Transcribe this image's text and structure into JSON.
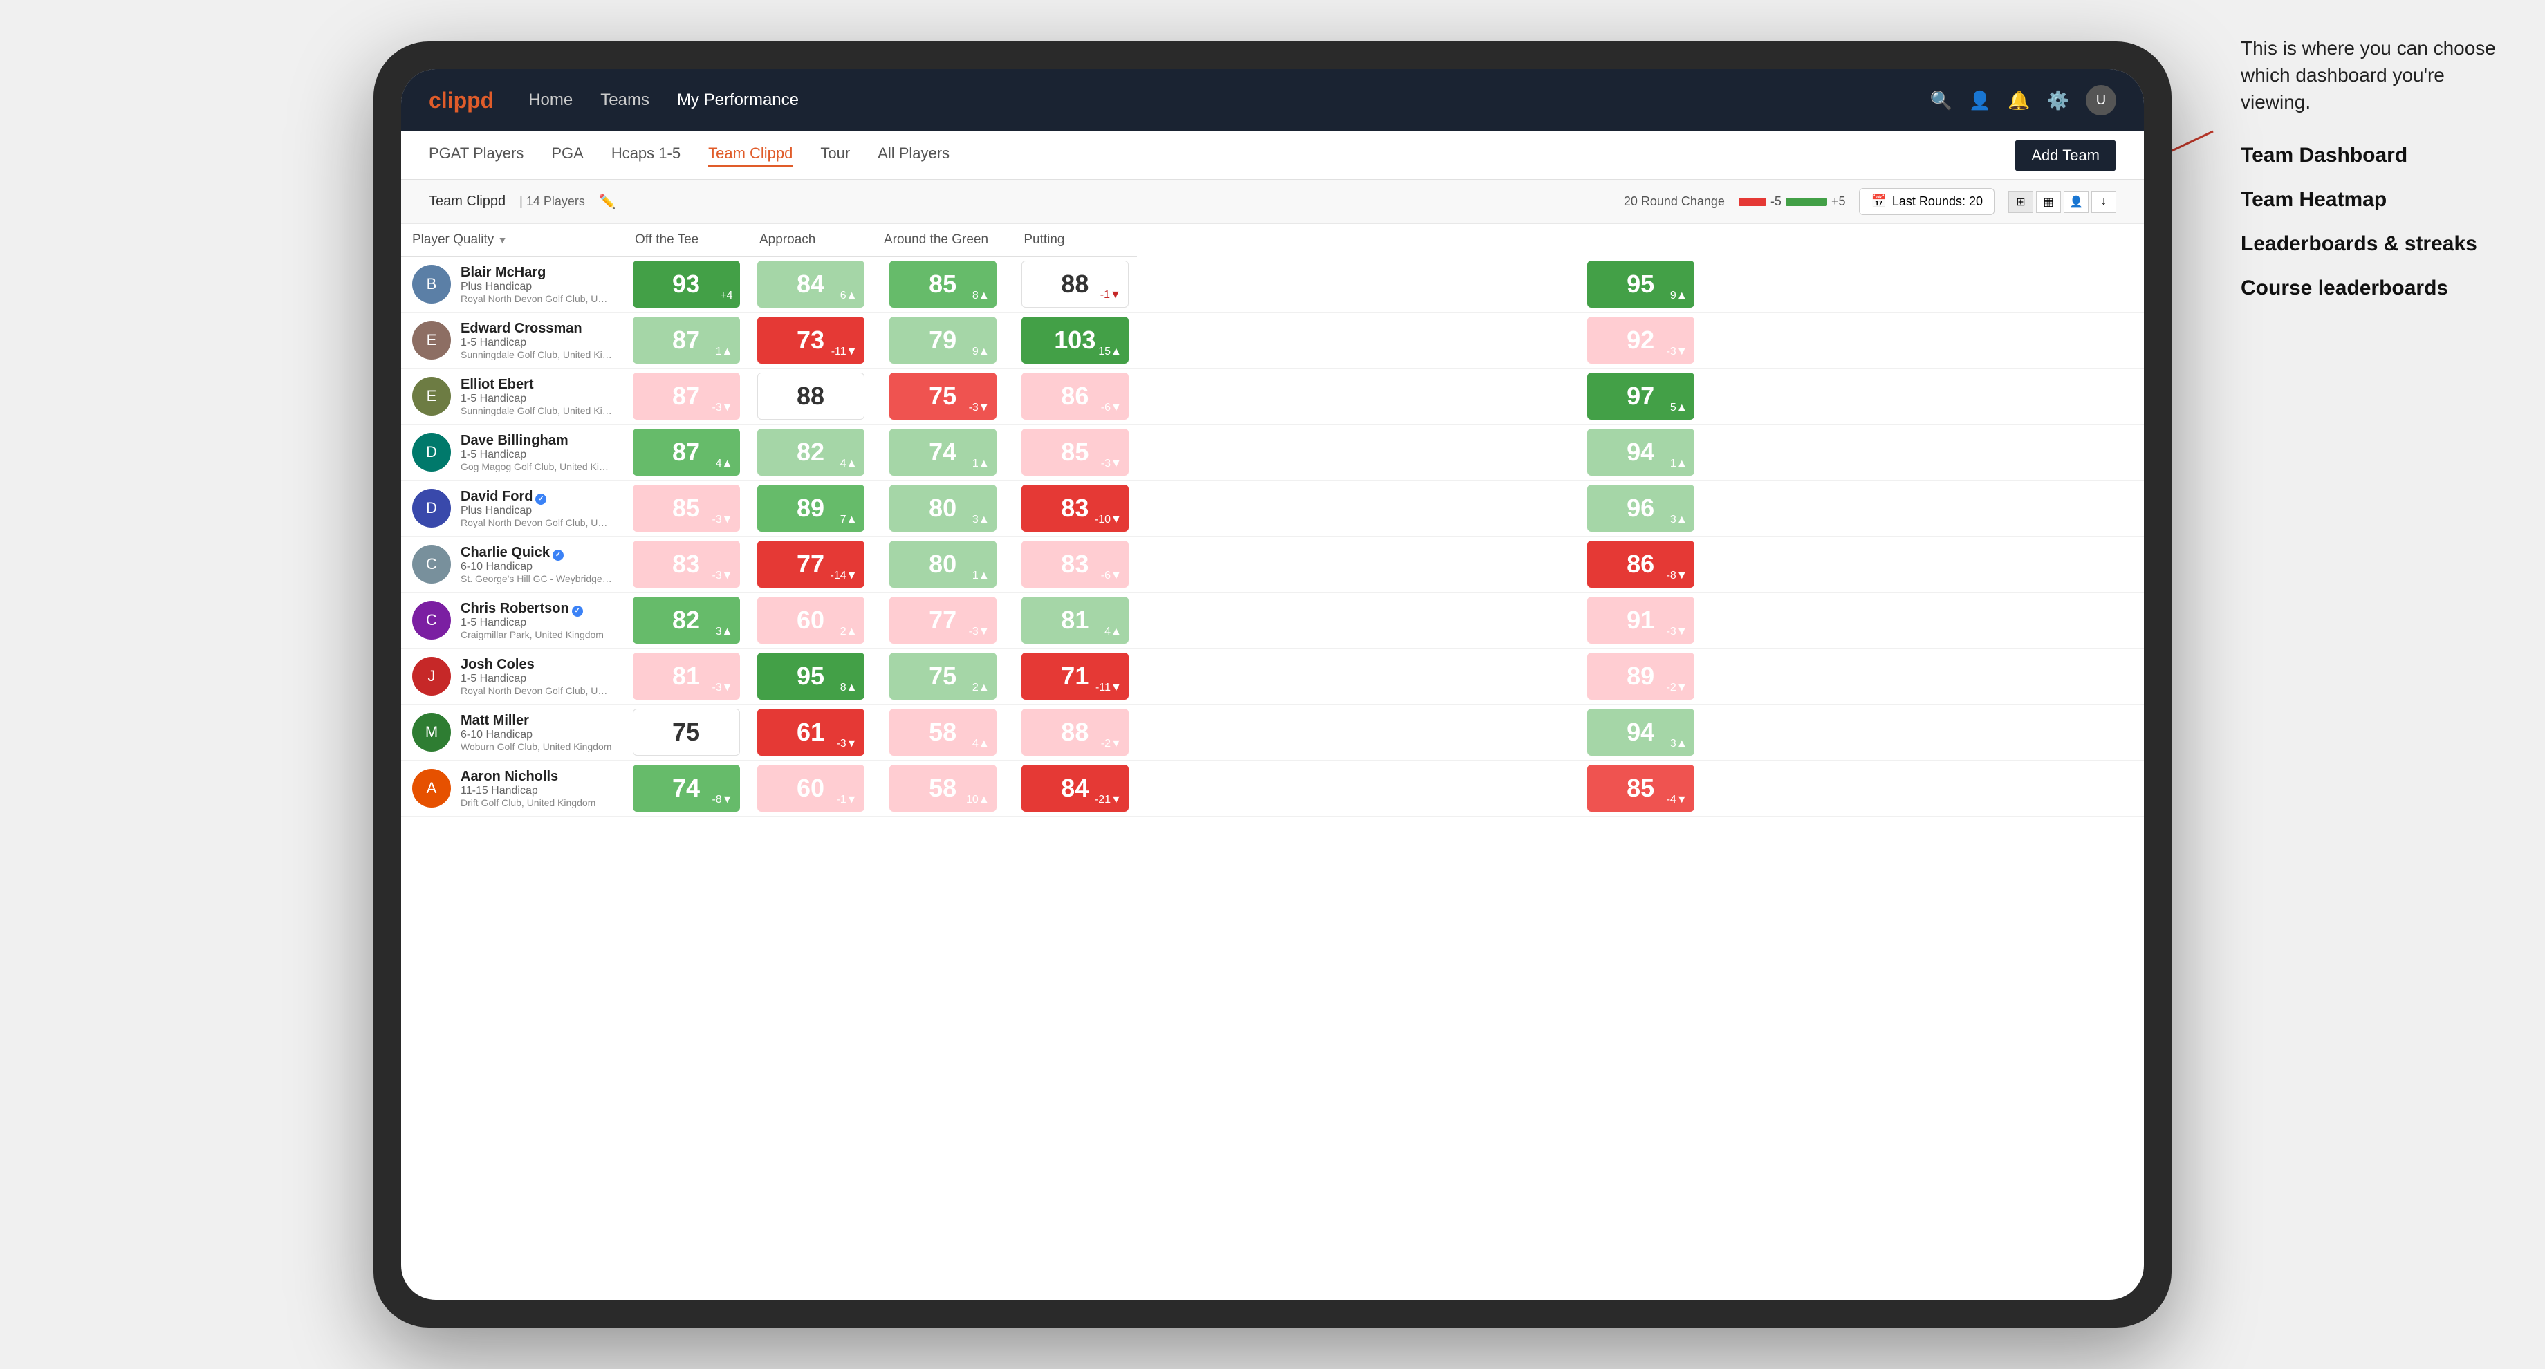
{
  "annotation": {
    "callout": "This is where you can choose which dashboard you're viewing.",
    "items": [
      "Team Dashboard",
      "Team Heatmap",
      "Leaderboards & streaks",
      "Course leaderboards"
    ]
  },
  "nav": {
    "logo": "clippd",
    "links": [
      "Home",
      "Teams",
      "My Performance"
    ],
    "active_link": "My Performance"
  },
  "sub_nav": {
    "links": [
      "PGAT Players",
      "PGA",
      "Hcaps 1-5",
      "Team Clippd",
      "Tour",
      "All Players"
    ],
    "active_link": "Team Clippd",
    "add_team_label": "Add Team"
  },
  "team_header": {
    "team_name": "Team Clippd",
    "separator": "|",
    "player_count": "14 Players",
    "round_change_label": "20 Round Change",
    "neg_label": "-5",
    "pos_label": "+5",
    "last_rounds_label": "Last Rounds: 20"
  },
  "columns": {
    "player_quality": "Player Quality",
    "off_tee": "Off the Tee",
    "approach": "Approach",
    "around_green": "Around the Green",
    "putting": "Putting"
  },
  "players": [
    {
      "name": "Blair McHarg",
      "handicap": "Plus Handicap",
      "club": "Royal North Devon Golf Club, United Kingdom",
      "avatar_color": "av-blue",
      "avatar_letter": "B",
      "scores": {
        "player_quality": {
          "value": 93,
          "change": "+4",
          "direction": "up",
          "bg": "bg-green-dark"
        },
        "off_tee": {
          "value": 84,
          "change": "6▲",
          "direction": "up",
          "bg": "bg-green-light"
        },
        "approach": {
          "value": 85,
          "change": "8▲",
          "direction": "up",
          "bg": "bg-green-med"
        },
        "around_green": {
          "value": 88,
          "change": "-1▼",
          "direction": "down",
          "bg": "bg-white"
        },
        "putting": {
          "value": 95,
          "change": "9▲",
          "direction": "up",
          "bg": "bg-green-dark"
        }
      }
    },
    {
      "name": "Edward Crossman",
      "handicap": "1-5 Handicap",
      "club": "Sunningdale Golf Club, United Kingdom",
      "avatar_color": "av-brown",
      "avatar_letter": "E",
      "scores": {
        "player_quality": {
          "value": 87,
          "change": "1▲",
          "direction": "up",
          "bg": "bg-green-light"
        },
        "off_tee": {
          "value": 73,
          "change": "-11▼",
          "direction": "down",
          "bg": "bg-red-dark"
        },
        "approach": {
          "value": 79,
          "change": "9▲",
          "direction": "up",
          "bg": "bg-green-light"
        },
        "around_green": {
          "value": 103,
          "change": "15▲",
          "direction": "up",
          "bg": "bg-green-dark"
        },
        "putting": {
          "value": 92,
          "change": "-3▼",
          "direction": "down",
          "bg": "bg-red-light"
        }
      }
    },
    {
      "name": "Elliot Ebert",
      "handicap": "1-5 Handicap",
      "club": "Sunningdale Golf Club, United Kingdom",
      "avatar_color": "av-olive",
      "avatar_letter": "E",
      "scores": {
        "player_quality": {
          "value": 87,
          "change": "-3▼",
          "direction": "down",
          "bg": "bg-red-light"
        },
        "off_tee": {
          "value": 88,
          "change": "",
          "direction": "",
          "bg": "bg-white"
        },
        "approach": {
          "value": 75,
          "change": "-3▼",
          "direction": "down",
          "bg": "bg-red-med"
        },
        "around_green": {
          "value": 86,
          "change": "-6▼",
          "direction": "down",
          "bg": "bg-red-light"
        },
        "putting": {
          "value": 97,
          "change": "5▲",
          "direction": "up",
          "bg": "bg-green-dark"
        }
      }
    },
    {
      "name": "Dave Billingham",
      "handicap": "1-5 Handicap",
      "club": "Gog Magog Golf Club, United Kingdom",
      "avatar_color": "av-teal",
      "avatar_letter": "D",
      "scores": {
        "player_quality": {
          "value": 87,
          "change": "4▲",
          "direction": "up",
          "bg": "bg-green-med"
        },
        "off_tee": {
          "value": 82,
          "change": "4▲",
          "direction": "up",
          "bg": "bg-green-light"
        },
        "approach": {
          "value": 74,
          "change": "1▲",
          "direction": "up",
          "bg": "bg-green-light"
        },
        "around_green": {
          "value": 85,
          "change": "-3▼",
          "direction": "down",
          "bg": "bg-red-light"
        },
        "putting": {
          "value": 94,
          "change": "1▲",
          "direction": "up",
          "bg": "bg-green-light"
        }
      }
    },
    {
      "name": "David Ford",
      "handicap": "Plus Handicap",
      "club": "Royal North Devon Golf Club, United Kingdom",
      "avatar_color": "av-navy",
      "avatar_letter": "D",
      "verified": true,
      "scores": {
        "player_quality": {
          "value": 85,
          "change": "-3▼",
          "direction": "down",
          "bg": "bg-red-light"
        },
        "off_tee": {
          "value": 89,
          "change": "7▲",
          "direction": "up",
          "bg": "bg-green-med"
        },
        "approach": {
          "value": 80,
          "change": "3▲",
          "direction": "up",
          "bg": "bg-green-light"
        },
        "around_green": {
          "value": 83,
          "change": "-10▼",
          "direction": "down",
          "bg": "bg-red-dark"
        },
        "putting": {
          "value": 96,
          "change": "3▲",
          "direction": "up",
          "bg": "bg-green-light"
        }
      }
    },
    {
      "name": "Charlie Quick",
      "handicap": "6-10 Handicap",
      "club": "St. George's Hill GC - Weybridge - Surrey, Uni...",
      "avatar_color": "av-gray",
      "avatar_letter": "C",
      "verified": true,
      "scores": {
        "player_quality": {
          "value": 83,
          "change": "-3▼",
          "direction": "down",
          "bg": "bg-red-light"
        },
        "off_tee": {
          "value": 77,
          "change": "-14▼",
          "direction": "down",
          "bg": "bg-red-dark"
        },
        "approach": {
          "value": 80,
          "change": "1▲",
          "direction": "up",
          "bg": "bg-green-light"
        },
        "around_green": {
          "value": 83,
          "change": "-6▼",
          "direction": "down",
          "bg": "bg-red-light"
        },
        "putting": {
          "value": 86,
          "change": "-8▼",
          "direction": "down",
          "bg": "bg-red-dark"
        }
      }
    },
    {
      "name": "Chris Robertson",
      "handicap": "1-5 Handicap",
      "club": "Craigmillar Park, United Kingdom",
      "avatar_color": "av-purple",
      "avatar_letter": "C",
      "verified": true,
      "scores": {
        "player_quality": {
          "value": 82,
          "change": "3▲",
          "direction": "up",
          "bg": "bg-green-med"
        },
        "off_tee": {
          "value": 60,
          "change": "2▲",
          "direction": "up",
          "bg": "bg-red-light"
        },
        "approach": {
          "value": 77,
          "change": "-3▼",
          "direction": "down",
          "bg": "bg-red-light"
        },
        "around_green": {
          "value": 81,
          "change": "4▲",
          "direction": "up",
          "bg": "bg-green-light"
        },
        "putting": {
          "value": 91,
          "change": "-3▼",
          "direction": "down",
          "bg": "bg-red-light"
        }
      }
    },
    {
      "name": "Josh Coles",
      "handicap": "1-5 Handicap",
      "club": "Royal North Devon Golf Club, United Kingdom",
      "avatar_color": "av-red",
      "avatar_letter": "J",
      "scores": {
        "player_quality": {
          "value": 81,
          "change": "-3▼",
          "direction": "down",
          "bg": "bg-red-light"
        },
        "off_tee": {
          "value": 95,
          "change": "8▲",
          "direction": "up",
          "bg": "bg-green-dark"
        },
        "approach": {
          "value": 75,
          "change": "2▲",
          "direction": "up",
          "bg": "bg-green-light"
        },
        "around_green": {
          "value": 71,
          "change": "-11▼",
          "direction": "down",
          "bg": "bg-red-dark"
        },
        "putting": {
          "value": 89,
          "change": "-2▼",
          "direction": "down",
          "bg": "bg-red-light"
        }
      }
    },
    {
      "name": "Matt Miller",
      "handicap": "6-10 Handicap",
      "club": "Woburn Golf Club, United Kingdom",
      "avatar_color": "av-green",
      "avatar_letter": "M",
      "scores": {
        "player_quality": {
          "value": 75,
          "change": "",
          "direction": "",
          "bg": "bg-white"
        },
        "off_tee": {
          "value": 61,
          "change": "-3▼",
          "direction": "down",
          "bg": "bg-red-dark"
        },
        "approach": {
          "value": 58,
          "change": "4▲",
          "direction": "up",
          "bg": "bg-red-light"
        },
        "around_green": {
          "value": 88,
          "change": "-2▼",
          "direction": "down",
          "bg": "bg-red-light"
        },
        "putting": {
          "value": 94,
          "change": "3▲",
          "direction": "up",
          "bg": "bg-green-light"
        }
      }
    },
    {
      "name": "Aaron Nicholls",
      "handicap": "11-15 Handicap",
      "club": "Drift Golf Club, United Kingdom",
      "avatar_color": "av-orange",
      "avatar_letter": "A",
      "scores": {
        "player_quality": {
          "value": 74,
          "change": "-8▼",
          "direction": "down",
          "bg": "bg-green-med"
        },
        "off_tee": {
          "value": 60,
          "change": "-1▼",
          "direction": "down",
          "bg": "bg-red-light"
        },
        "approach": {
          "value": 58,
          "change": "10▲",
          "direction": "up",
          "bg": "bg-red-light"
        },
        "around_green": {
          "value": 84,
          "change": "-21▼",
          "direction": "down",
          "bg": "bg-red-dark"
        },
        "putting": {
          "value": 85,
          "change": "-4▼",
          "direction": "down",
          "bg": "bg-red-med"
        }
      }
    }
  ]
}
